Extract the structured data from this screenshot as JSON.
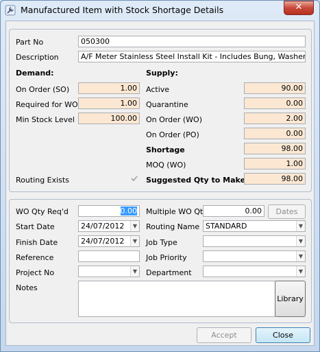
{
  "window": {
    "title": "Manufactured Item with Stock Shortage Details",
    "close_glyph": "✕"
  },
  "item": {
    "part_no_label": "Part No",
    "part_no": "050300",
    "description_label": "Description",
    "description": "A/F Meter Stainless Steel Install Kit - Includes Bung, Washer & Plug B"
  },
  "demand": {
    "heading": "Demand:",
    "on_order_label": "On Order (SO)",
    "on_order": "1.00",
    "required_label": "Required for WO",
    "required": "1.00",
    "min_stock_label": "Min Stock Level",
    "min_stock": "100.00"
  },
  "supply": {
    "heading": "Supply:",
    "active_label": "Active",
    "active": "90.00",
    "quarantine_label": "Quarantine",
    "quarantine": "0.00",
    "on_order_wo_label": "On Order (WO)",
    "on_order_wo": "2.00",
    "on_order_po_label": "On Order (PO)",
    "on_order_po": "0.00",
    "shortage_label": "Shortage",
    "shortage": "98.00",
    "moq_label": "MOQ (WO)",
    "moq": "1.00",
    "suggested_label": "Suggested Qty to Make",
    "suggested": "98.00"
  },
  "routing_exists_label": "Routing Exists",
  "routing_exists_checked": true,
  "wo": {
    "qty_label": "WO Qty Req'd",
    "qty": "0.00",
    "multiple_label": "Multiple WO Qty",
    "multiple": "0.00",
    "dates_button": "Dates",
    "start_label": "Start Date",
    "start": "24/07/2012",
    "routing_label": "Routing Name",
    "routing": "STANDARD",
    "finish_label": "Finish Date",
    "finish": "24/07/2012",
    "job_type_label": "Job Type",
    "job_type": "",
    "reference_label": "Reference",
    "reference": "",
    "job_priority_label": "Job Priority",
    "job_priority": "",
    "project_label": "Project No",
    "project": "",
    "department_label": "Department",
    "department": "",
    "notes_label": "Notes",
    "notes": "",
    "library_button": "Library"
  },
  "footer": {
    "accept": "Accept",
    "close": "Close"
  },
  "icons": {
    "app": "wrench-icon",
    "dropdown": "chevron-down-icon",
    "check": "checkmark-icon"
  }
}
